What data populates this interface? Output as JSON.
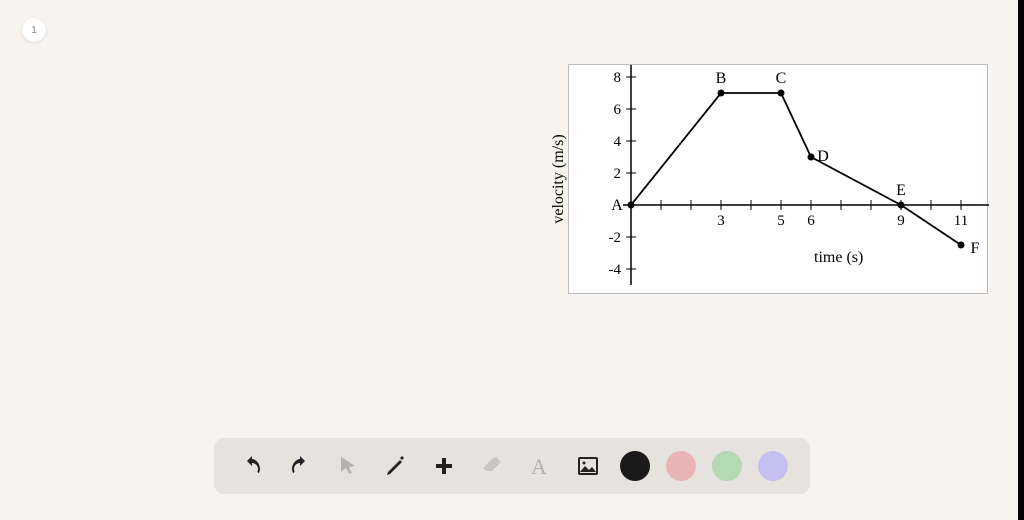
{
  "page_badge": "1",
  "chart_data": {
    "type": "line",
    "title": "",
    "xlabel": "time (s)",
    "ylabel": "velocity (m/s)",
    "xlim": [
      0,
      12
    ],
    "ylim": [
      -5,
      9
    ],
    "x_ticks_labeled": [
      3,
      5,
      6,
      9,
      11
    ],
    "y_ticks_labeled": [
      8,
      6,
      4,
      2,
      -2,
      -4
    ],
    "series": [
      {
        "name": "velocity",
        "points": [
          {
            "label": "A",
            "x": 0,
            "y": 0
          },
          {
            "label": "B",
            "x": 3,
            "y": 7
          },
          {
            "label": "C",
            "x": 5,
            "y": 7
          },
          {
            "label": "D",
            "x": 6,
            "y": 3
          },
          {
            "label": "E",
            "x": 9,
            "y": 0
          },
          {
            "label": "F",
            "x": 11,
            "y": -2.5
          }
        ]
      }
    ]
  },
  "toolbar": {
    "undo": "Undo",
    "redo": "Redo",
    "pointer": "Pointer",
    "pencil": "Pencil",
    "add": "Add",
    "eraser": "Eraser",
    "text": "Text",
    "image": "Image"
  },
  "colors": {
    "black": "#1a1a1a",
    "pink": "#e8b5b5",
    "green": "#b5d8b5",
    "purple": "#c5c0f0"
  }
}
